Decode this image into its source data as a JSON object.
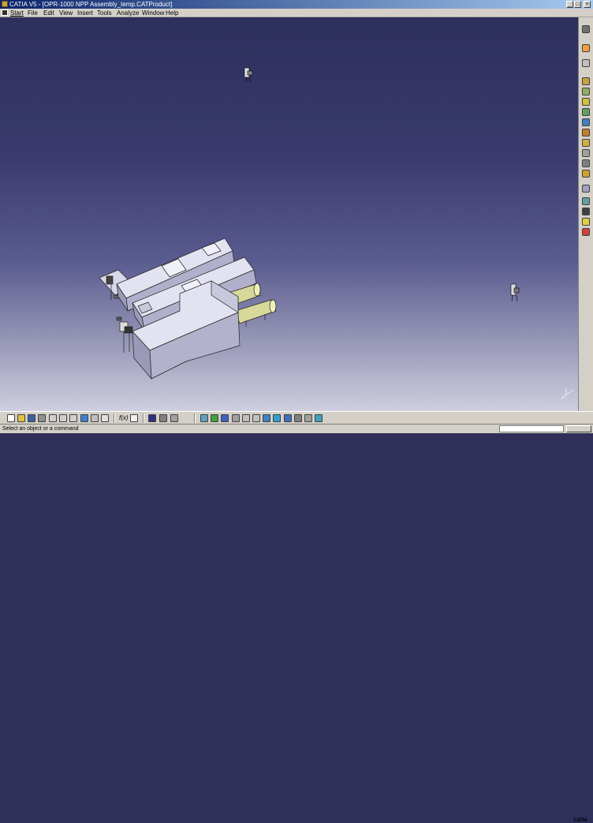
{
  "window": {
    "title": "CATIA V5 - [OPR-1000 NPP Assembly_temp.CATProduct]",
    "minimize_glyph": "_",
    "maximize_glyph": "□",
    "close_glyph": "×"
  },
  "menubar": {
    "items": [
      "Start",
      "File",
      "Edit",
      "View",
      "Insert",
      "Tools",
      "Analyze",
      "Window",
      "Help"
    ]
  },
  "toolbar": {
    "fo_label": "f(x)"
  },
  "status": {
    "message": "Select an object or a command",
    "command_value": ""
  },
  "brand": {
    "logo_text": "CATIA"
  },
  "colors": {
    "background_top": "#2d2f5c",
    "background_bottom": "#cfcfe0",
    "model_gray": "#c4c4dc",
    "pipe_yellow": "#d7d89a"
  }
}
